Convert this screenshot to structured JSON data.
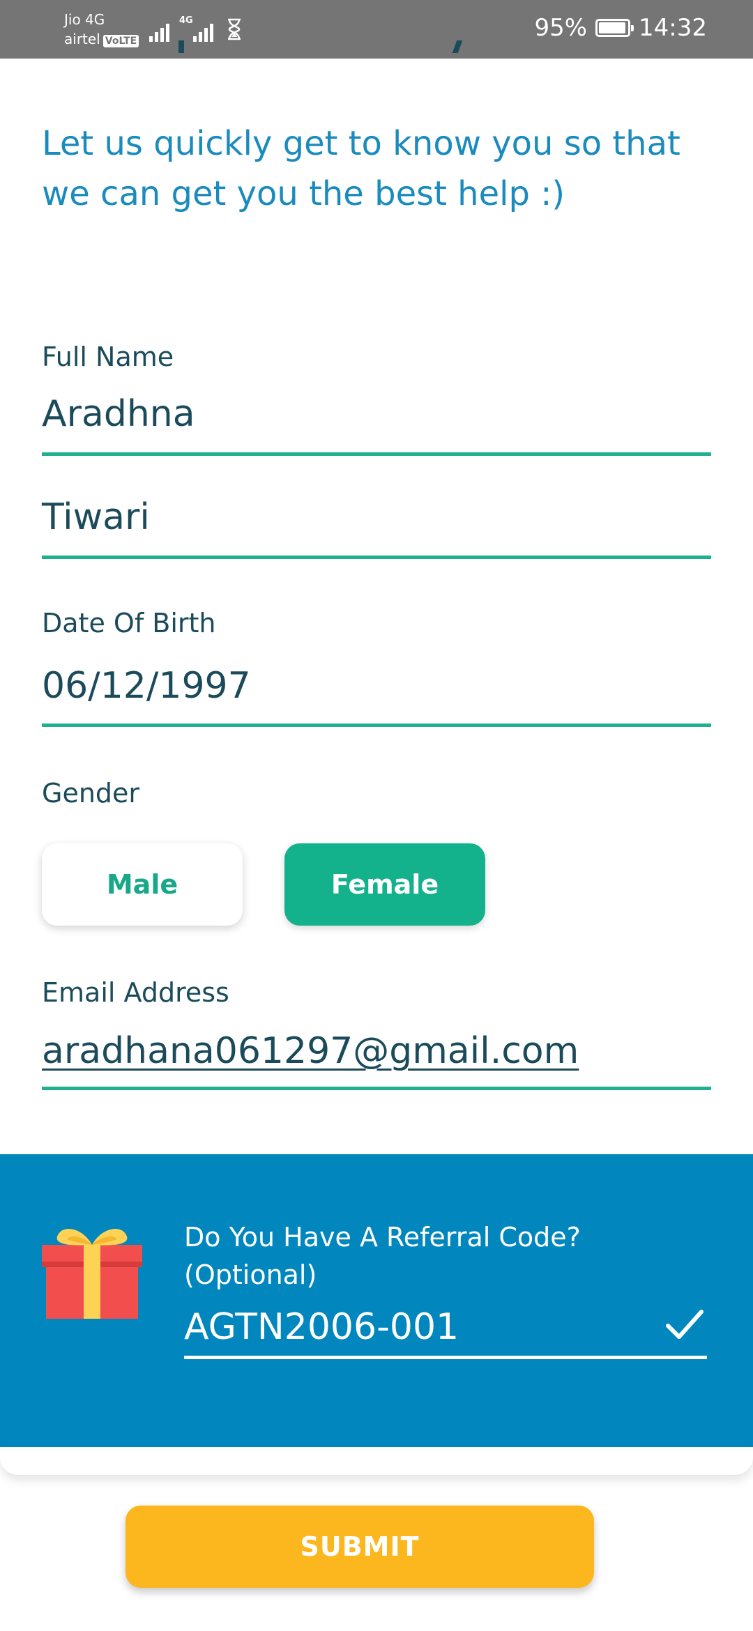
{
  "status_bar": {
    "carrier_1": "Jio 4G",
    "carrier_2": "airtel",
    "volte_badge": "VoLTE",
    "network_tag": "4G",
    "battery_percent": "95%",
    "time": "14:32"
  },
  "form": {
    "intro": "Let us quickly get to know you so that we can get you the best help :)",
    "full_name_label": "Full Name",
    "first_name_value": "Aradhna",
    "last_name_value": "Tiwari",
    "dob_label": "Date Of Birth",
    "dob_value": "06/12/1997",
    "gender_label": "Gender",
    "gender_options": [
      "Male",
      "Female"
    ],
    "gender_selected": "Female",
    "email_label": "Email Address",
    "email_value": "aradhana061297@gmail.com"
  },
  "referral": {
    "question": "Do You Have A Referral Code? (Optional)",
    "code_value": "AGTN2006-001"
  },
  "submit_label": "SUBMIT",
  "colors": {
    "accent_green": "#13b28c",
    "intro_blue": "#1a8bbd",
    "referral_bg": "#0186bd",
    "submit_yellow": "#fbb71d",
    "text_dark": "#1b4b5a"
  }
}
